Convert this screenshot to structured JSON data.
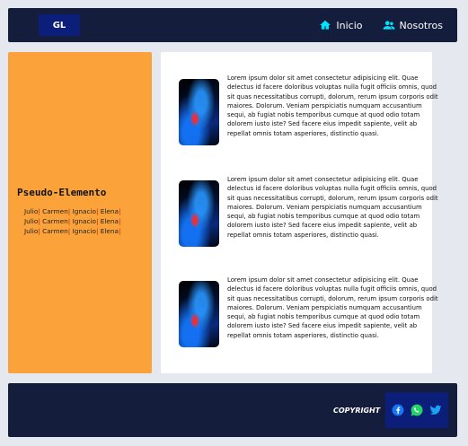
{
  "header": {
    "logo": "GL",
    "nav": [
      {
        "label": "Inicio",
        "icon": "home-icon"
      },
      {
        "label": "Nosotros",
        "icon": "users-icon"
      }
    ]
  },
  "aside": {
    "title": "Pseudo-Elemento",
    "rows": [
      [
        "Julio",
        "Carmen",
        "Ignacio",
        "Elena"
      ],
      [
        "Julio",
        "Carmen",
        "Ignacio",
        "Elena"
      ],
      [
        "Julio",
        "Carmen",
        "Ignacio",
        "Elena"
      ]
    ]
  },
  "cards": [
    {
      "text": "Lorem ipsum dolor sit amet consectetur adipisicing elit. Quae delectus id facere doloribus voluptas nulla fugit officiis omnis, quod sit quas necessitatibus corrupti, dolorum, rerum ipsum corporis odit maiores. Dolorum. Veniam perspiciatis numquam accusantium sequi, ab fugiat nobis temporibus cumque at quod odio totam dolorem iusto iste? Sed facere eius impedit sapiente, velit ab repellat omnis totam asperiores, distinctio quasi."
    },
    {
      "text": "Lorem ipsum dolor sit amet consectetur adipisicing elit. Quae delectus id facere doloribus voluptas nulla fugit officiis omnis, quod sit quas necessitatibus corrupti, dolorum, rerum ipsum corporis odit maiores. Dolorum. Veniam perspiciatis numquam accusantium sequi, ab fugiat nobis temporibus cumque at quod odio totam dolorem iusto iste? Sed facere eius impedit sapiente, velit ab repellat omnis totam asperiores, distinctio quasi."
    },
    {
      "text": "Lorem ipsum dolor sit amet consectetur adipisicing elit. Quae delectus id facere doloribus voluptas nulla fugit officiis omnis, quod sit quas necessitatibus corrupti, dolorum, rerum ipsum corporis odit maiores. Dolorum. Veniam perspiciatis numquam accusantium sequi, ab fugiat nobis temporibus cumque at quod odio totam dolorem iusto iste? Sed facere eius impedit sapiente, velit ab repellat omnis totam asperiores, distinctio quasi."
    }
  ],
  "footer": {
    "copyright": "COPYRIGHT",
    "social": [
      "facebook-icon",
      "whatsapp-icon",
      "twitter-icon"
    ]
  },
  "colors": {
    "navy": "#141d3b",
    "brand_blue": "#0b1f7a",
    "accent_cyan": "#00e5ff",
    "aside_orange": "#fba33a",
    "separator_red": "#c4161c"
  }
}
